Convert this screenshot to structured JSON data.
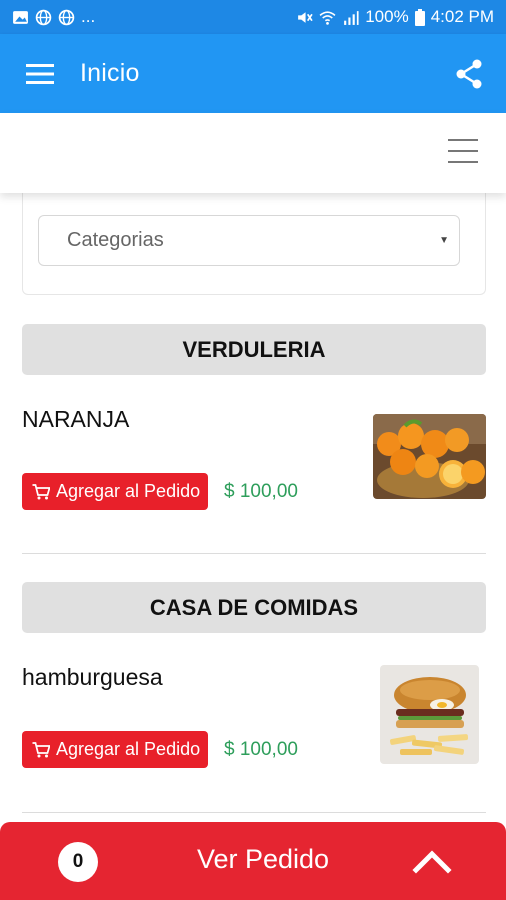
{
  "status_bar": {
    "overflow": "...",
    "battery": "100%",
    "time": "4:02 PM",
    "left_icons": [
      "image-icon",
      "globe-icon",
      "globe-icon"
    ],
    "right_icons": [
      "mute-icon",
      "wifi-icon",
      "signal-icon",
      "battery-icon"
    ]
  },
  "app_bar": {
    "title": "Inicio",
    "menu_icon": "hamburger-menu-icon",
    "share_icon": "share-icon"
  },
  "filter": {
    "category_placeholder": "Categorias"
  },
  "sections": [
    {
      "title": "VERDULERIA",
      "products": [
        {
          "name": "NARANJA",
          "add_label": "Agregar al Pedido",
          "price": "$ 100,00",
          "image": "oranges-photo"
        }
      ]
    },
    {
      "title": "CASA DE COMIDAS",
      "products": [
        {
          "name": "hamburguesa",
          "add_label": "Agregar al Pedido",
          "price": "$ 100,00",
          "image": "burger-photo"
        }
      ]
    }
  ],
  "bottom_bar": {
    "order_count": "0",
    "label": "Ver Pedido",
    "toggle_icon": "chevron-up-icon"
  },
  "colors": {
    "status_bar": "#1e88e5",
    "app_bar": "#2196f3",
    "accent_red": "#e52531",
    "price_green": "#2e9e5b",
    "section_gray": "#e0e0e0"
  }
}
